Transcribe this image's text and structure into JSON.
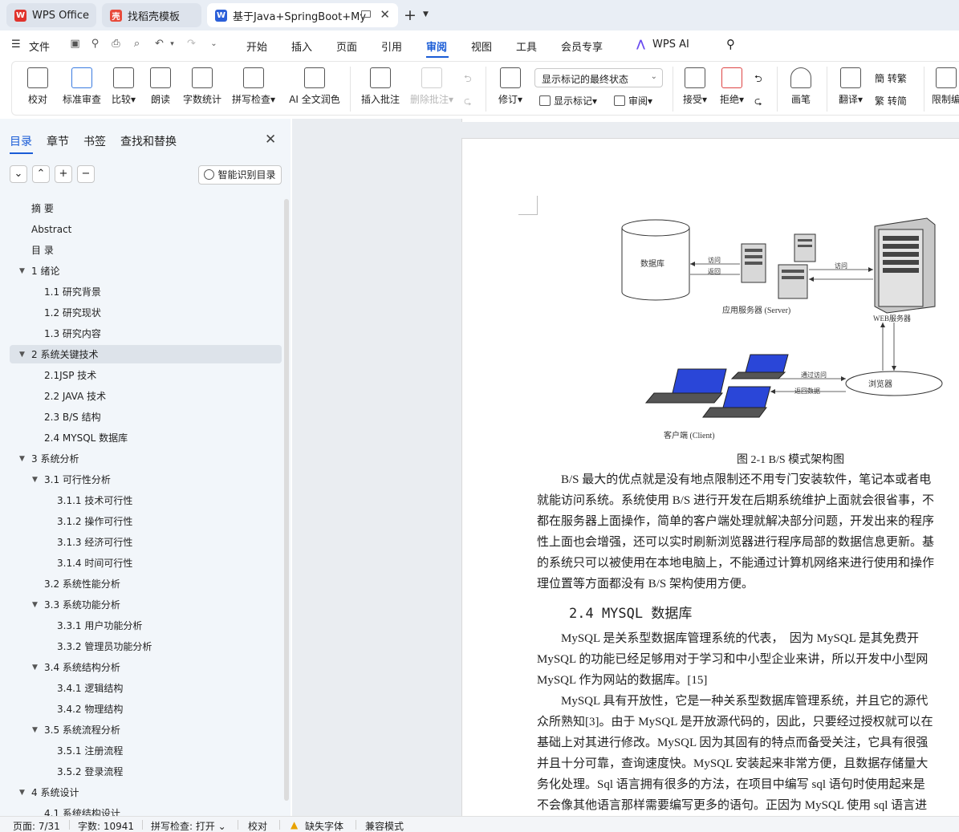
{
  "tabs": [
    {
      "label": "WPS Office",
      "icon": "wps-logo-icon"
    },
    {
      "label": "找稻壳模板",
      "icon": "docer-icon"
    },
    {
      "label": "基于Java+SpringBoot+My",
      "icon": "word-doc-icon",
      "active": true
    }
  ],
  "menu": {
    "file": "文件",
    "items": [
      "开始",
      "插入",
      "页面",
      "引用",
      "审阅",
      "视图",
      "工具",
      "会员专享"
    ],
    "active": "审阅",
    "ai": "WPS AI"
  },
  "ribbon": {
    "proofread": "校对",
    "standard_review": "标准审查",
    "compare": "比较",
    "read_aloud": "朗读",
    "word_count": "字数统计",
    "spell_check": "拼写检查",
    "ai_polish": "AI 全文润色",
    "insert_comment": "插入批注",
    "delete_comment": "删除批注",
    "track_changes": "修订",
    "markup_select": "显示标记的最终状态",
    "show_markup": "显示标记",
    "review_pane": "审阅",
    "accept": "接受",
    "reject": "拒绝",
    "pen": "画笔",
    "translate": "翻译",
    "to_traditional": "转繁",
    "to_simplified": "转简",
    "restrict_edit": "限制编"
  },
  "nav": {
    "tabs": [
      "目录",
      "章节",
      "书签",
      "查找和替换"
    ],
    "active_tab": "目录",
    "ai_toc_button": "智能识别目录",
    "toc": [
      {
        "text": "摘  要",
        "level": 1,
        "toggle": ""
      },
      {
        "text": "Abstract",
        "level": 1,
        "toggle": ""
      },
      {
        "text": "目  录",
        "level": 1,
        "toggle": ""
      },
      {
        "text": "1  绪论",
        "level": 1,
        "toggle": "▼"
      },
      {
        "text": "1.1  研究背景",
        "level": 2,
        "toggle": ""
      },
      {
        "text": "1.2  研究现状",
        "level": 2,
        "toggle": ""
      },
      {
        "text": "1.3  研究内容",
        "level": 2,
        "toggle": ""
      },
      {
        "text": "2  系统关键技术",
        "level": 1,
        "toggle": "▼",
        "selected": true
      },
      {
        "text": "2.1JSP 技术",
        "level": 2,
        "toggle": ""
      },
      {
        "text": "2.2 JAVA 技术",
        "level": 2,
        "toggle": ""
      },
      {
        "text": "2.3 B/S 结构",
        "level": 2,
        "toggle": ""
      },
      {
        "text": "2.4 MYSQL 数据库",
        "level": 2,
        "toggle": ""
      },
      {
        "text": "3  系统分析",
        "level": 1,
        "toggle": "▼"
      },
      {
        "text": "3.1  可行性分析",
        "level": 2,
        "toggle": "▼"
      },
      {
        "text": "3.1.1  技术可行性",
        "level": 3,
        "toggle": ""
      },
      {
        "text": "3.1.2  操作可行性",
        "level": 3,
        "toggle": ""
      },
      {
        "text": "3.1.3  经济可行性",
        "level": 3,
        "toggle": ""
      },
      {
        "text": "3.1.4  时间可行性",
        "level": 3,
        "toggle": ""
      },
      {
        "text": "3.2 系统性能分析",
        "level": 2,
        "toggle": ""
      },
      {
        "text": "3.3 系统功能分析",
        "level": 2,
        "toggle": "▼"
      },
      {
        "text": "3.3.1 用户功能分析",
        "level": 3,
        "toggle": ""
      },
      {
        "text": "3.3.2 管理员功能分析",
        "level": 3,
        "toggle": ""
      },
      {
        "text": "3.4  系统结构分析",
        "level": 2,
        "toggle": "▼"
      },
      {
        "text": "3.4.1 逻辑结构",
        "level": 3,
        "toggle": ""
      },
      {
        "text": "3.4.2 物理结构",
        "level": 3,
        "toggle": ""
      },
      {
        "text": "3.5  系统流程分析",
        "level": 2,
        "toggle": "▼"
      },
      {
        "text": "3.5.1 注册流程",
        "level": 3,
        "toggle": ""
      },
      {
        "text": "3.5.2 登录流程",
        "level": 3,
        "toggle": ""
      },
      {
        "text": "4  系统设计",
        "level": 1,
        "toggle": "▼"
      },
      {
        "text": "4.1 系统结构设计",
        "level": 2,
        "toggle": ""
      }
    ]
  },
  "document": {
    "figure": {
      "database": "数据库",
      "access": "访问",
      "return": "返回",
      "access2": "访问",
      "app_server": "应用服务器 (Server)",
      "web_server": "WEB服务器",
      "browser": "浏览器",
      "via_access": "通过访问",
      "return_data": "返回数据",
      "client": "客户端 (Client)"
    },
    "caption": "图 2-1 B/S 模式架构图",
    "lines1": [
      "　　B/S 最大的优点就是没有地点限制还不用专门安装软件，笔记本或者电",
      "就能访问系统。系统使用 B/S 进行开发在后期系统维护上面就会很省事，不",
      "都在服务器上面操作，简单的客户端处理就解决部分问题，开发出来的程序",
      "性上面也会增强，还可以实时刷新浏览器进行程序局部的数据信息更新。基",
      "的系统只可以被使用在本地电脑上，不能通过计算机网络来进行使用和操作",
      "理位置等方面都没有 B/S 架构使用方便。"
    ],
    "heading": "2.4 MYSQL 数据库",
    "lines2": [
      "　　MySQL 是关系型数据库管理系统的代表，　因为 MySQL 是其免费开",
      "MySQL 的功能已经足够用对于学习和中小型企业来讲，所以开发中小型网",
      "MySQL 作为网站的数据库。[15]",
      "　　MySQL 具有开放性，它是一种关系型数据库管理系统，并且它的源代",
      "众所熟知[3]。由于 MySQL 是开放源代码的，因此，只要经过授权就可以在",
      "基础上对其进行修改。MySQL 因为其固有的特点而备受关注，它具有很强",
      "并且十分可靠，查询速度快。MySQL 安装起来非常方便，且数据存储量大",
      "务化处理。Sql 语言拥有很多的方法，在项目中编写 sql 语句时使用起来是",
      "不会像其他语言那样需要编写更多的语句。正因为 MySQL 使用 sql 语言进"
    ]
  },
  "status": {
    "page": "页面: 7/31",
    "words": "字数: 10941",
    "spell": "拼写检查: 打开",
    "proof": "校对",
    "missing_font": "缺失字体",
    "compat": "兼容模式"
  }
}
